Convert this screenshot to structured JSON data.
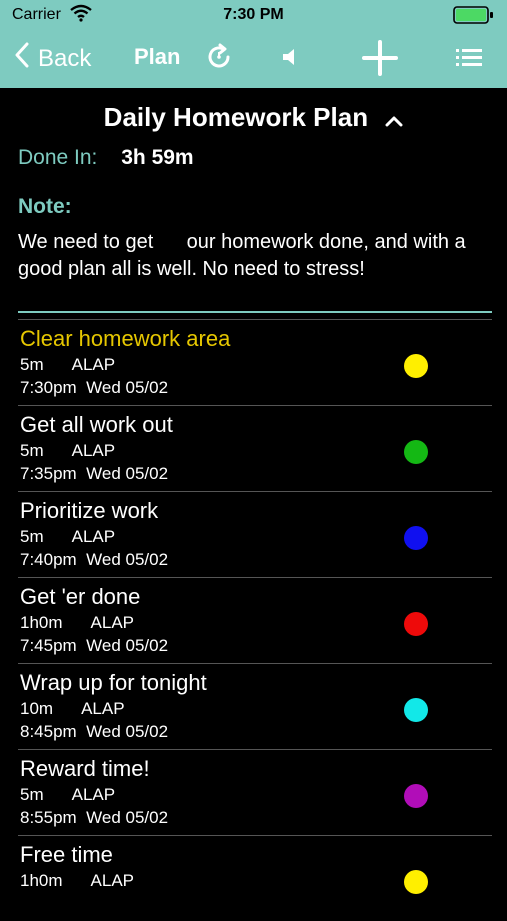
{
  "status": {
    "carrier": "Carrier",
    "time": "7:30 PM"
  },
  "nav": {
    "back_label": "Back",
    "title": "Plan"
  },
  "plan": {
    "title": "Daily Homework Plan",
    "done_label": "Done In:",
    "done_value": "3h 59m",
    "note_label": "Note:",
    "note_text": "We need to get      our homework done, and with a good plan all is well. No need to stress!"
  },
  "tasks": [
    {
      "name": "Clear homework area",
      "duration": "5m",
      "mode": "ALAP",
      "time": "7:30pm",
      "date": "Wed 05/02",
      "color": "#ffef00",
      "name_color": "#e6c700"
    },
    {
      "name": "Get all work out",
      "duration": "5m",
      "mode": "ALAP",
      "time": "7:35pm",
      "date": "Wed 05/02",
      "color": "#14b814",
      "name_color": "#ffffff"
    },
    {
      "name": "Prioritize work",
      "duration": "5m",
      "mode": "ALAP",
      "time": "7:40pm",
      "date": "Wed 05/02",
      "color": "#1010f0",
      "name_color": "#ffffff"
    },
    {
      "name": "Get 'er done",
      "duration": "1h0m",
      "mode": "ALAP",
      "time": "7:45pm",
      "date": "Wed 05/02",
      "color": "#ee0a0a",
      "name_color": "#ffffff"
    },
    {
      "name": "Wrap up for tonight",
      "duration": "10m",
      "mode": "ALAP",
      "time": "8:45pm",
      "date": "Wed 05/02",
      "color": "#12e8e8",
      "name_color": "#ffffff"
    },
    {
      "name": "Reward time!",
      "duration": "5m",
      "mode": "ALAP",
      "time": "8:55pm",
      "date": "Wed 05/02",
      "color": "#b10db8",
      "name_color": "#ffffff"
    },
    {
      "name": "Free time",
      "duration": "1h0m",
      "mode": "ALAP",
      "time": "",
      "date": "",
      "color": "#ffef00",
      "name_color": "#ffffff"
    }
  ],
  "icons": {
    "back": "chevron-left-icon",
    "refresh": "refresh-icon",
    "sound": "speaker-icon",
    "add": "plus-icon",
    "menu": "list-icon"
  }
}
